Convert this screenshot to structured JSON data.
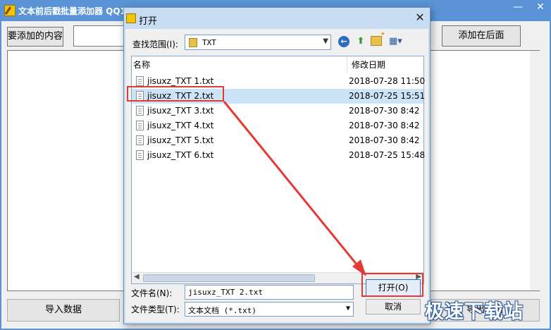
{
  "app": {
    "title": "文本前后戳批量添加器 QQ1",
    "title_tail": "…",
    "content_button": "要添加的内容",
    "append_button": "添加在后面",
    "import_button": "导入数据",
    "export_button": "导出数据",
    "minimize": "—",
    "close": "✕"
  },
  "dialog": {
    "title": "打开",
    "close": "✕",
    "look_in_label": "查找范围(I):",
    "look_in_value": "TXT",
    "columns": {
      "name": "名称",
      "date": "修改日期"
    },
    "files": [
      {
        "name": "jisuxz_TXT 1.txt",
        "date": "2018-07-28 11:50"
      },
      {
        "name": "jisuxz_TXT 2.txt",
        "date": "2018-07-25 15:51"
      },
      {
        "name": "jisuxz_TXT 3.txt",
        "date": "2018-07-30 8:42"
      },
      {
        "name": "jisuxz_TXT 4.txt",
        "date": "2018-07-30 8:42"
      },
      {
        "name": "jisuxz_TXT 5.txt",
        "date": "2018-07-30 8:42"
      },
      {
        "name": "jisuxz_TXT 6.txt",
        "date": "2018-07-25 15:48"
      }
    ],
    "selected_index": 1,
    "filename_label": "文件名(N):",
    "filename_value": "jisuxz_TXT 2.txt",
    "filetype_label": "文件类型(T):",
    "filetype_value": "文本文档 (*.txt)",
    "open_button": "打开(O)",
    "cancel_button": "取消"
  },
  "watermark": "极速下载站",
  "colors": {
    "annotation": "#e53935",
    "titlebar": "#5a94d6",
    "selection": "#cce4f7"
  }
}
